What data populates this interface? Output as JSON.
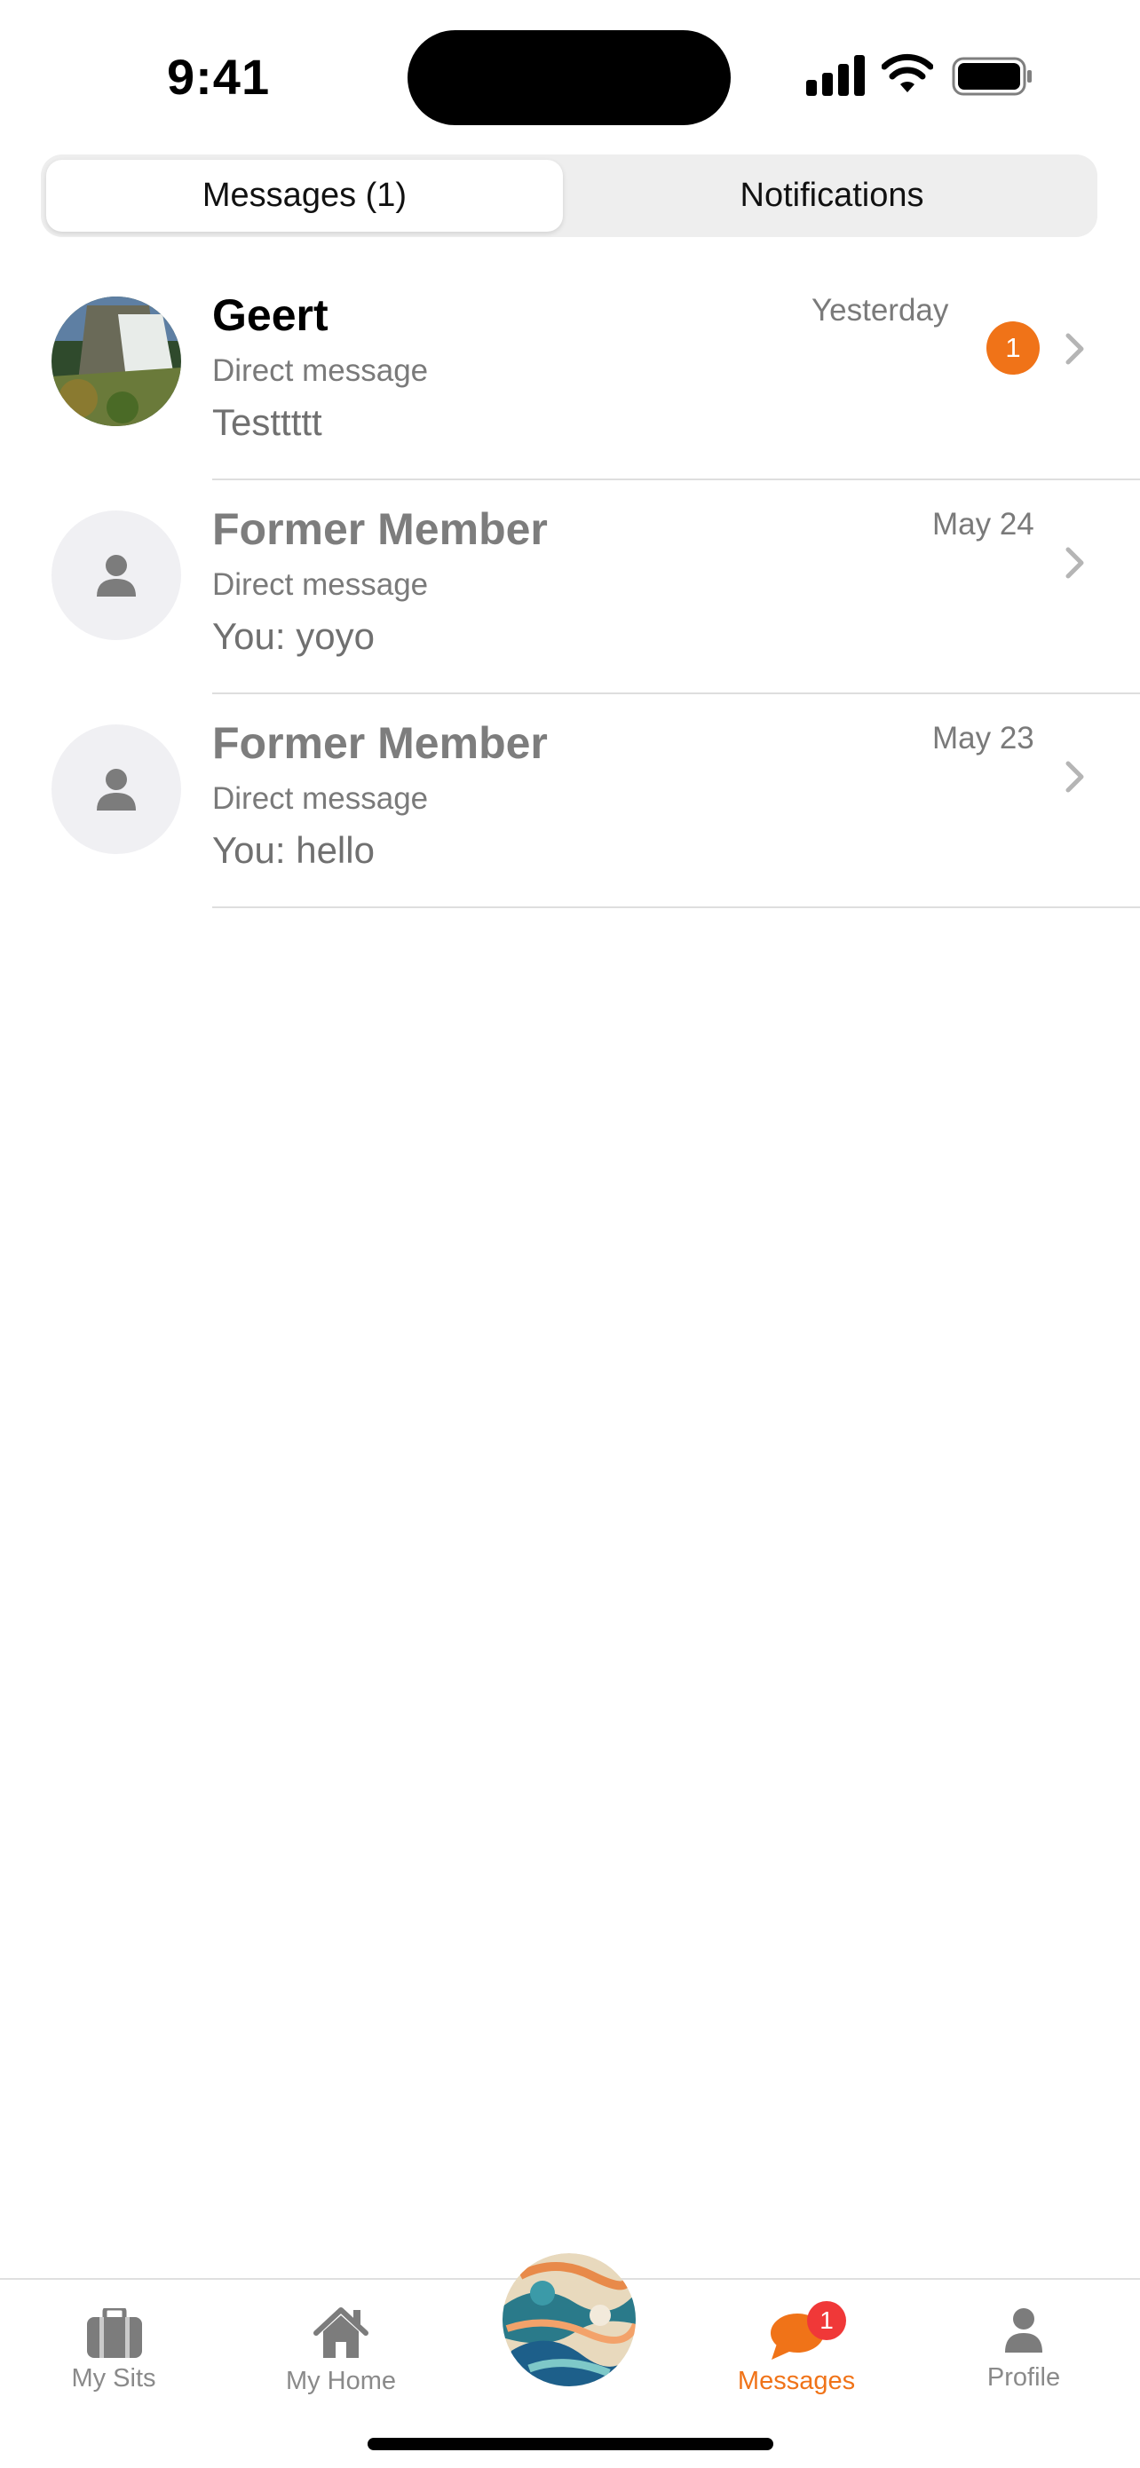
{
  "status": {
    "time": "9:41"
  },
  "segmented": {
    "messages_label": "Messages (1)",
    "notifications_label": "Notifications"
  },
  "conversations": [
    {
      "name": "Geert",
      "subtitle": "Direct message",
      "preview": "Testtttt",
      "date": "Yesterday",
      "unread_count": "1",
      "avatar": "photo-waterfall"
    },
    {
      "name": "Former Member",
      "subtitle": "Direct message",
      "preview": "You: yoyo",
      "date": "May 24",
      "avatar": "person-placeholder"
    },
    {
      "name": "Former Member",
      "subtitle": "Direct message",
      "preview": "You: hello",
      "date": "May 23",
      "avatar": "person-placeholder"
    }
  ],
  "tabbar": {
    "items": [
      {
        "label": "My Sits",
        "icon": "suitcase-icon"
      },
      {
        "label": "My Home",
        "icon": "house-icon"
      },
      {
        "label": "",
        "icon": "globe-logo"
      },
      {
        "label": "Messages",
        "icon": "chat-bubble-icon",
        "badge": "1",
        "active": true
      },
      {
        "label": "Profile",
        "icon": "person-icon"
      }
    ]
  },
  "colors": {
    "accent": "#f07318",
    "badge_red": "#f03838",
    "muted_text": "#7a7a7a"
  }
}
